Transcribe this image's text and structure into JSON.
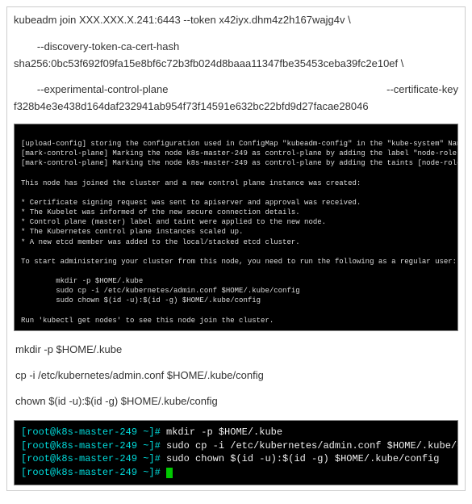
{
  "top_commands": {
    "line1": "kubeadm join XXX.XXX.X.241:6443 --token x42iyx.dhm4z2h167wajg4v \\",
    "line2_indent": "        --discovery-token-ca-cert-hash sha256:0bc53f692f09fa15e8bf6c72b3fb024d8baaa11347fbe35453ceba39fc2e10ef \\",
    "line3_left": "        --experimental-control-plane",
    "line3_right": "--certificate-key",
    "line4": "f328b4e3e438d164daf232941ab954f73f14591e632bc22bfd9d27facae28046"
  },
  "terminal1": {
    "l1": "[upload-config] storing the configuration used in ConfigMap \"kubeadm-config\" in the \"kube-system\" Namespace",
    "l2": "[mark-control-plane] Marking the node k8s-master-249 as control-plane by adding the label \"node-role.kubernetes.io/master=''\"",
    "l3": "[mark-control-plane] Marking the node k8s-master-249 as control-plane by adding the taints [node-role.kubernetes.io/master:NoSchedu",
    "l4": "",
    "l5": "This node has joined the cluster and a new control plane instance was created:",
    "l6": "",
    "l7": "* Certificate signing request was sent to apiserver and approval was received.",
    "l8": "* The Kubelet was informed of the new secure connection details.",
    "l9": "* Control plane (master) label and taint were applied to the new node.",
    "l10": "* The Kubernetes control plane instances scaled up.",
    "l11": "* A new etcd member was added to the local/stacked etcd cluster.",
    "l12": "",
    "l13": "To start administering your cluster from this node, you need to run the following as a regular user:",
    "l14": "",
    "l15": "        mkdir -p $HOME/.kube",
    "l16": "        sudo cp -i /etc/kubernetes/admin.conf $HOME/.kube/config",
    "l17": "        sudo chown $(id -u):$(id -g) $HOME/.kube/config",
    "l18": "",
    "l19": "Run 'kubectl get nodes' to see this node join the cluster."
  },
  "post_commands": {
    "c1": "mkdir -p $HOME/.kube",
    "c2": "cp -i /etc/kubernetes/admin.conf $HOME/.kube/config",
    "c3": "chown $(id -u):$(id -g) $HOME/.kube/config"
  },
  "terminal2": {
    "prompt_user": "[root@k8s-master-249 ~]# ",
    "cmd1": "mkdir -p $HOME/.kube",
    "cmd2": "sudo cp -i /etc/kubernetes/admin.conf $HOME/.kube/confi",
    "cmd3": "sudo chown $(id -u):$(id -g) $HOME/.kube/config"
  }
}
